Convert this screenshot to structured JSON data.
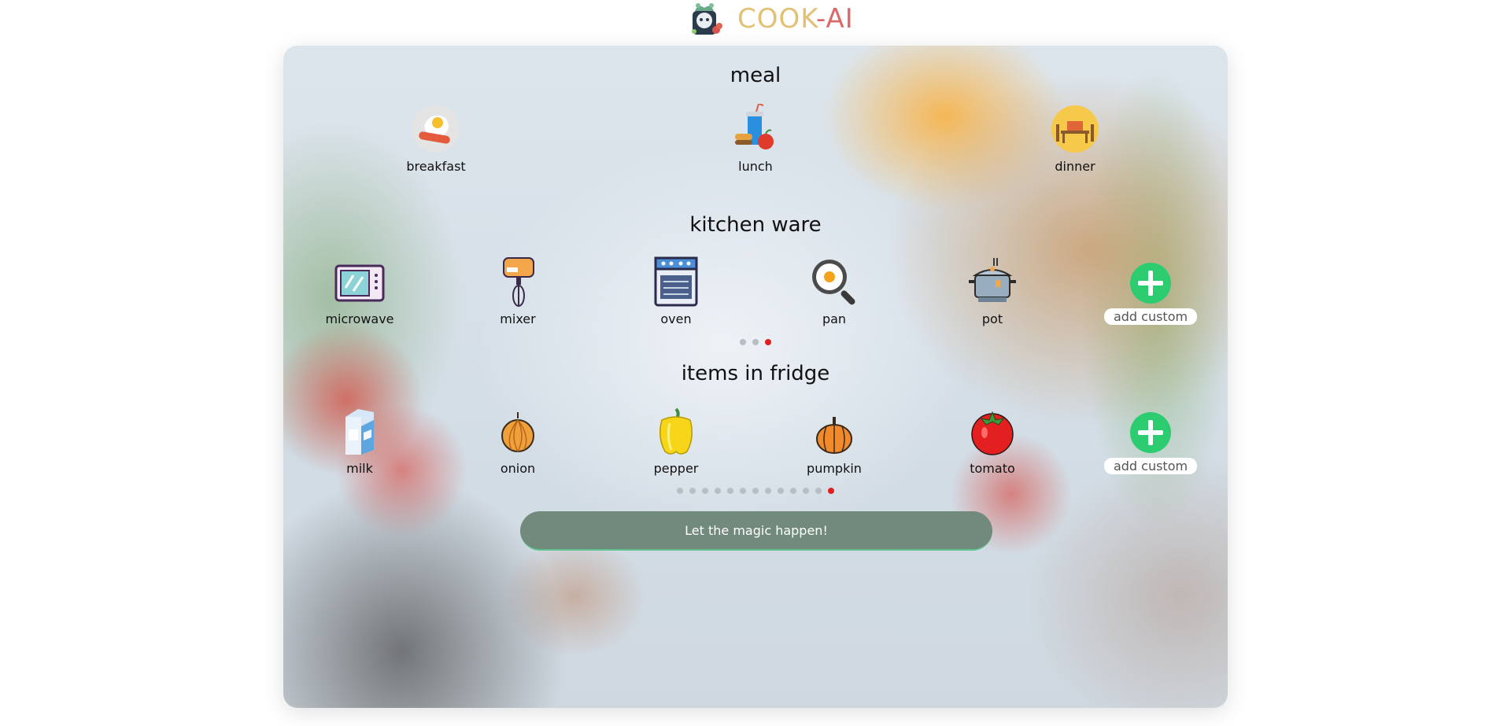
{
  "header": {
    "brand_part1": "COOK",
    "brand_part2": "-AI",
    "logo_icon": "chef-robot-logo-icon",
    "colors": {
      "brand_gold": "#e2c074",
      "brand_red": "#d96a6a"
    }
  },
  "meal": {
    "title": "meal",
    "items": [
      {
        "label": "breakfast",
        "icon": "fried-egg-sausage-icon"
      },
      {
        "label": "lunch",
        "icon": "soda-burger-apple-icon"
      },
      {
        "label": "dinner",
        "icon": "dining-table-icon"
      }
    ]
  },
  "kitchen_ware": {
    "title": "kitchen ware",
    "items": [
      {
        "label": "microwave",
        "icon": "microwave-icon"
      },
      {
        "label": "mixer",
        "icon": "mixer-icon"
      },
      {
        "label": "oven",
        "icon": "oven-icon"
      },
      {
        "label": "pan",
        "icon": "frying-pan-icon"
      },
      {
        "label": "pot",
        "icon": "pot-icon"
      }
    ],
    "add_label": "add custom",
    "page_dots": 3,
    "active_page": 3
  },
  "fridge": {
    "title": "items in fridge",
    "items": [
      {
        "label": "milk",
        "icon": "milk-carton-icon"
      },
      {
        "label": "onion",
        "icon": "onion-icon"
      },
      {
        "label": "pepper",
        "icon": "bell-pepper-icon"
      },
      {
        "label": "pumpkin",
        "icon": "pumpkin-icon"
      },
      {
        "label": "tomato",
        "icon": "tomato-icon"
      }
    ],
    "add_label": "add custom",
    "page_dots": 13,
    "active_page": 13
  },
  "submit_label": "Let the magic happen!",
  "colors": {
    "button_bg": "#718a7c",
    "add_green": "#2ecc71",
    "active_dot": "#e02020",
    "inactive_dot": "#b9bec4"
  }
}
